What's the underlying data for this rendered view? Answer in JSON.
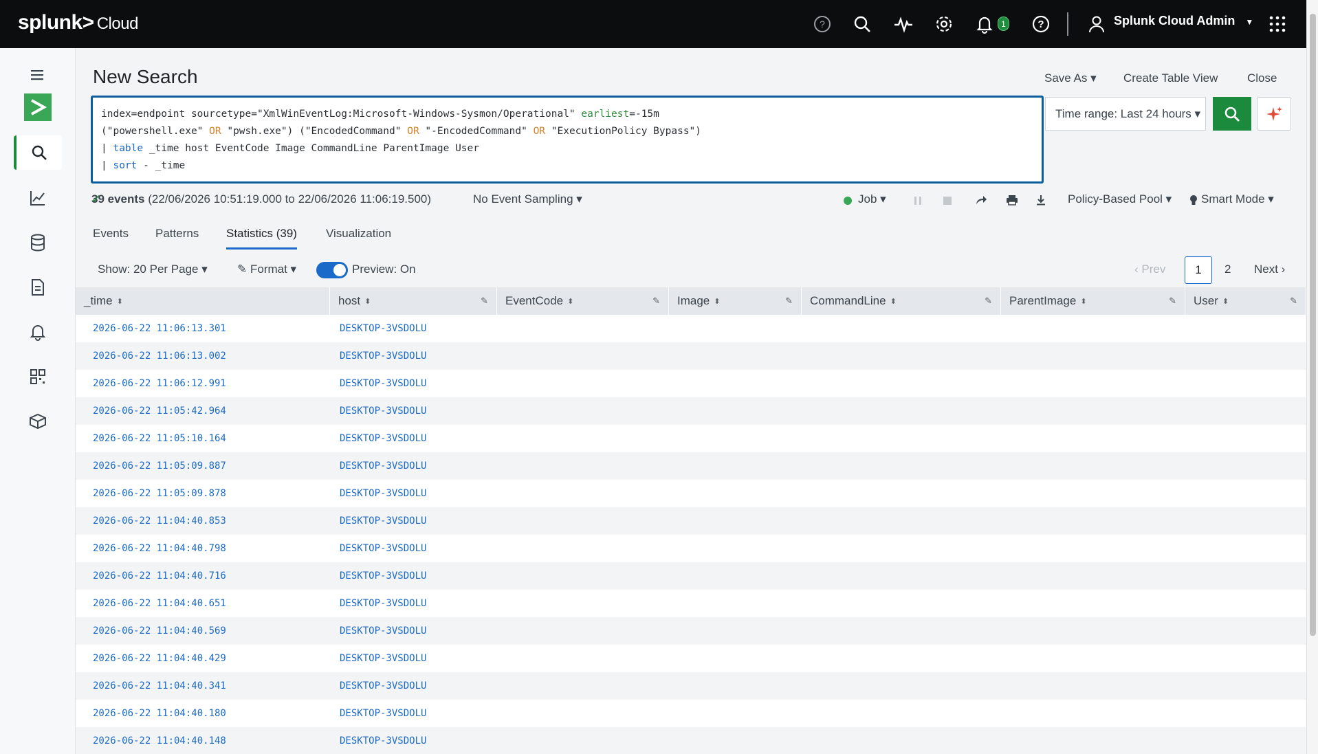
{
  "topbar": {
    "logo_main": "splunk>",
    "logo_sub": "Cloud",
    "notification_count": "1",
    "user_name": "Splunk Cloud Admin"
  },
  "header": {
    "title": "New Search",
    "save_as": "Save As ▾",
    "create_table_view": "Create Table View",
    "close": "Close"
  },
  "search": {
    "line1_a": "index=endpoint sourcetype=\"XmlWinEventLog:Microsoft-Windows-Sysmon/Operational\" ",
    "line1_kw": "earliest",
    "line1_b": "=-15m",
    "line2_a": "(\"powershell.exe\" ",
    "line2_or1": "OR",
    "line2_b": " \"pwsh.exe\") (\"EncodedCommand\" ",
    "line2_or2": "OR",
    "line2_c": " \"-EncodedCommand\" ",
    "line2_or3": "OR",
    "line2_d": " \"ExecutionPolicy Bypass\")",
    "line3_pipe": "| ",
    "line3_cmd": "table",
    "line3_rest": " _time host EventCode Image CommandLine ParentImage User",
    "line4_pipe": "| ",
    "line4_cmd": "sort",
    "line4_rest": " - _time",
    "time_range": "Time range: Last 24 hours ▾"
  },
  "status": {
    "check": "✓",
    "event_count": "39 events",
    "range": "(22/06/2026 10:51:19.000 to 22/06/2026 11:06:19.500)",
    "sampling": "No Event Sampling ▾",
    "job": "Job ▾",
    "pool": "Policy-Based Pool ▾",
    "mode": "Smart Mode ▾"
  },
  "tabs": [
    "Events",
    "Patterns",
    "Statistics (39)",
    "Visualization"
  ],
  "toolbar": {
    "show": "Show: 20 Per Page ▾",
    "format": "Format ▾",
    "preview": "Preview: On",
    "prev": "‹ Prev",
    "page1": "1",
    "page2": "2",
    "next": "Next ›"
  },
  "table": {
    "columns": [
      "_time",
      "host",
      "EventCode",
      "Image",
      "CommandLine",
      "ParentImage",
      "User"
    ],
    "rows": [
      {
        "time": "2026-06-22 11:06:13.301",
        "host": "DESKTOP-3VSDOLU"
      },
      {
        "time": "2026-06-22 11:06:13.002",
        "host": "DESKTOP-3VSDOLU"
      },
      {
        "time": "2026-06-22 11:06:12.991",
        "host": "DESKTOP-3VSDOLU"
      },
      {
        "time": "2026-06-22 11:05:42.964",
        "host": "DESKTOP-3VSDOLU"
      },
      {
        "time": "2026-06-22 11:05:10.164",
        "host": "DESKTOP-3VSDOLU"
      },
      {
        "time": "2026-06-22 11:05:09.887",
        "host": "DESKTOP-3VSDOLU"
      },
      {
        "time": "2026-06-22 11:05:09.878",
        "host": "DESKTOP-3VSDOLU"
      },
      {
        "time": "2026-06-22 11:04:40.853",
        "host": "DESKTOP-3VSDOLU"
      },
      {
        "time": "2026-06-22 11:04:40.798",
        "host": "DESKTOP-3VSDOLU"
      },
      {
        "time": "2026-06-22 11:04:40.716",
        "host": "DESKTOP-3VSDOLU"
      },
      {
        "time": "2026-06-22 11:04:40.651",
        "host": "DESKTOP-3VSDOLU"
      },
      {
        "time": "2026-06-22 11:04:40.569",
        "host": "DESKTOP-3VSDOLU"
      },
      {
        "time": "2026-06-22 11:04:40.429",
        "host": "DESKTOP-3VSDOLU"
      },
      {
        "time": "2026-06-22 11:04:40.341",
        "host": "DESKTOP-3VSDOLU"
      },
      {
        "time": "2026-06-22 11:04:40.180",
        "host": "DESKTOP-3VSDOLU"
      },
      {
        "time": "2026-06-22 11:04:40.148",
        "host": "DESKTOP-3VSDOLU"
      }
    ]
  },
  "colors": {
    "accent": "#1c8a3d",
    "link": "#1b6ac9",
    "topbar": "#0c0d0e",
    "search_border": "#0a5e9e"
  }
}
